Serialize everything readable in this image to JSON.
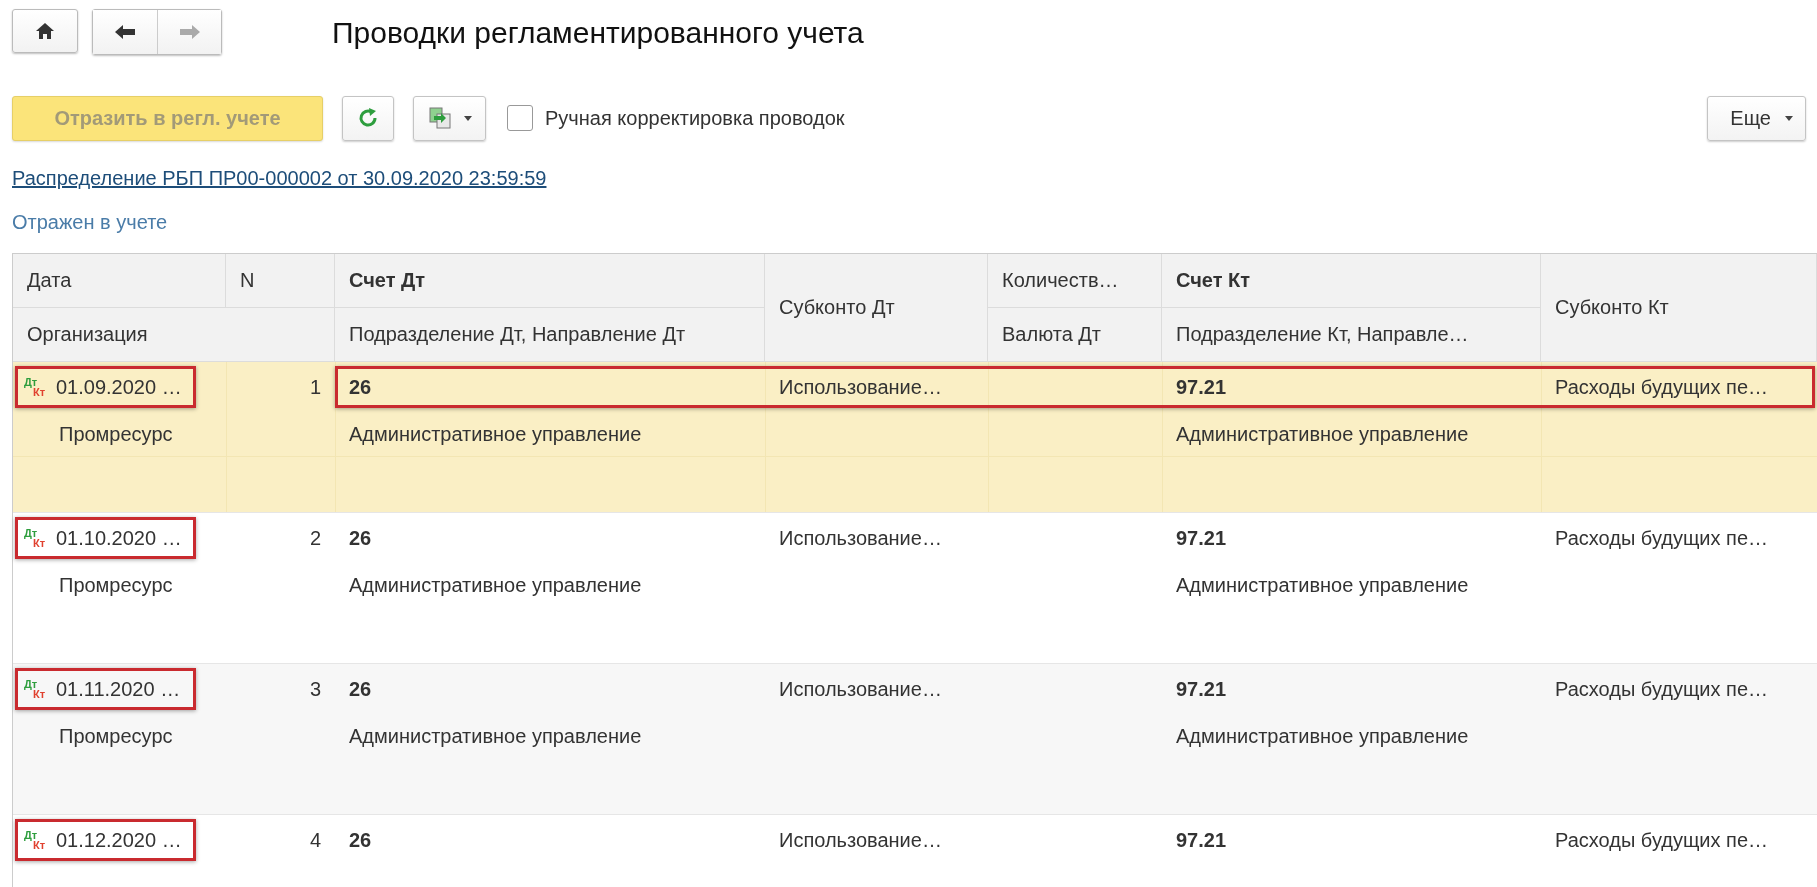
{
  "window": {
    "title": "Проводки регламентированного учета",
    "forward_enabled": false
  },
  "toolbar": {
    "post_button": {
      "label": "Отразить в регл. учете",
      "disabled": true
    },
    "manual_checkbox": {
      "label": "Ручная корректировка проводок",
      "checked": false
    },
    "more_button": "Еще"
  },
  "document_link": "Распределение РБП ПР00-000002 от 30.09.2020 23:59:59",
  "status": "Отражен в учете",
  "table": {
    "columns": {
      "date": "Дата",
      "n": "N",
      "account_dt": "Счет Дт",
      "subconto_dt": "Субконто Дт",
      "quantity": "Количеств…",
      "account_kt": "Счет Кт",
      "subconto_kt": "Субконто Кт",
      "organization": "Организация",
      "dept_dt": "Подразделение Дт, Направление Дт",
      "currency_dt": "Валюта Дт",
      "dept_kt": "Подразделение Кт, Направле…"
    },
    "rows": [
      {
        "selected": true,
        "date_marked": true,
        "entry_marked": true,
        "mark_dt": "Дт",
        "mark_kt": "Кт",
        "date": "01.09.2020 …",
        "n": "1",
        "account_dt": "26",
        "subconto_dt": "Использование…",
        "account_kt": "97.21",
        "subconto_kt": "Расходы будущих пе…",
        "organization": "Промресурс",
        "dept_dt": "Административное управление",
        "dept_kt": "Административное управление"
      },
      {
        "selected": false,
        "date_marked": true,
        "entry_marked": false,
        "mark_dt": "Дт",
        "mark_kt": "Кт",
        "date": "01.10.2020 …",
        "n": "2",
        "account_dt": "26",
        "subconto_dt": "Использование…",
        "account_kt": "97.21",
        "subconto_kt": "Расходы будущих пе…",
        "organization": "Промресурс",
        "dept_dt": "Административное управление",
        "dept_kt": "Административное управление"
      },
      {
        "selected": false,
        "date_marked": true,
        "entry_marked": false,
        "mark_dt": "Дт",
        "mark_kt": "Кт",
        "date": "01.11.2020 …",
        "n": "3",
        "account_dt": "26",
        "subconto_dt": "Использование…",
        "account_kt": "97.21",
        "subconto_kt": "Расходы будущих пе…",
        "organization": "Промресурс",
        "dept_dt": "Административное управление",
        "dept_kt": "Административное управление"
      },
      {
        "selected": false,
        "date_marked": true,
        "entry_marked": false,
        "mark_dt": "Дт",
        "mark_kt": "Кт",
        "date": "01.12.2020 …",
        "n": "4",
        "account_dt": "26",
        "subconto_dt": "Использование…",
        "account_kt": "97.21",
        "subconto_kt": "Расходы будущих пе…"
      }
    ]
  }
}
